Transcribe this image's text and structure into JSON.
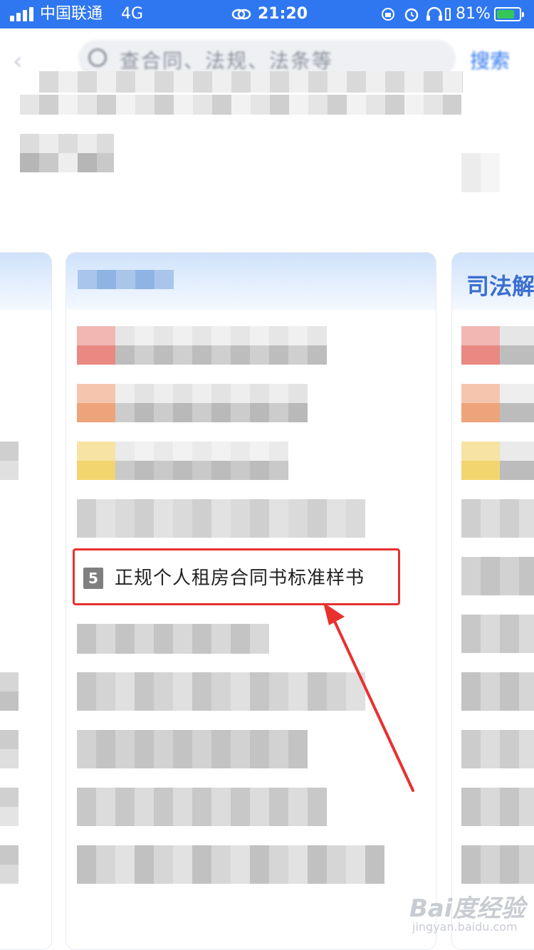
{
  "status_bar": {
    "carrier": "中国联通",
    "network": "4G",
    "time": "21:20",
    "battery_percent": "81%",
    "battery_level": 0.81,
    "icons": [
      "signal-icon",
      "link-icon",
      "rotation-lock-icon",
      "alarm-icon",
      "headphones-icon",
      "battery-charging-icon"
    ]
  },
  "header": {
    "back_icon": "chevron-left-icon",
    "search_placeholder": "查合同、法规、法条等",
    "search_button": "搜索"
  },
  "cards": {
    "right_card_title": "司法解"
  },
  "highlighted_item": {
    "rank": "5",
    "title": "正规个人租房合同书标准样书"
  },
  "watermark": {
    "brand": "Bai度经验",
    "url": "jingyan.baidu.com"
  },
  "colors": {
    "status_bar_bg": "#2f77f1",
    "accent": "#2f77f1",
    "highlight_border": "#e8312f",
    "arrow": "#e8312f",
    "badge_bg": "#7f7f7f"
  }
}
